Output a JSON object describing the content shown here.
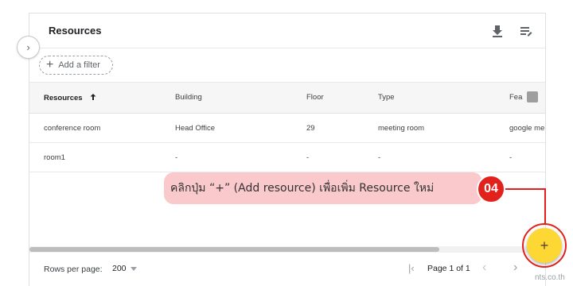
{
  "header": {
    "title": "Resources"
  },
  "filter": {
    "label": "Add a filter"
  },
  "table": {
    "columns": [
      "Resources",
      "Building",
      "Floor",
      "Type",
      "Fea"
    ],
    "rows": [
      [
        "conference room",
        "Head Office",
        "29",
        "meeting room",
        "google me"
      ],
      [
        "room1",
        "-",
        "-",
        "-",
        "-"
      ]
    ]
  },
  "footer": {
    "rows_per_page_label": "Rows per page:",
    "rows_per_page_value": "200",
    "page_text": "Page 1 of 1"
  },
  "annotation": {
    "text": "คลิกปุ่ม “+” (Add resource) เพื่อเพิ่ม Resource ใหม่",
    "step": "04",
    "color": "#e2211c"
  },
  "fab": {
    "label": "+",
    "color": "#fdd835"
  },
  "watermark": "nts.co.th"
}
